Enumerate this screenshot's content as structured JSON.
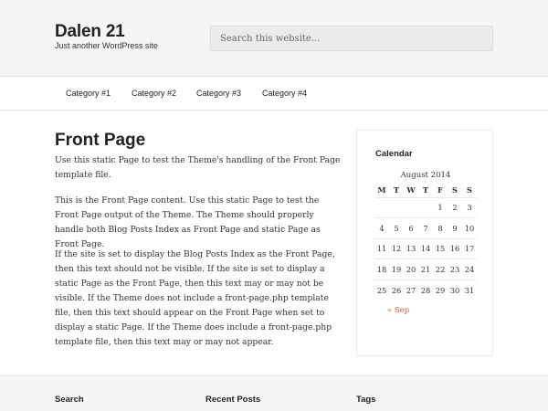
{
  "site": {
    "title": "Dalen 21",
    "tagline": "Just another WordPress site"
  },
  "search": {
    "placeholder": "Search this website..."
  },
  "nav": {
    "items": [
      "Category #1",
      "Category #2",
      "Category #3",
      "Category #4"
    ]
  },
  "page": {
    "title": "Front Page",
    "paragraphs": [
      "Use this static Page to test the Theme's handling of the Front Page template file.",
      "This is the Front Page content. Use this static Page to test the Front Page output of the Theme. The Theme should properly handle both Blog Posts Index as Front Page and static Page as Front Page.",
      "If the site is set to display the Blog Posts Index as the Front Page, then this text should not be visible. If the site is set to display a static Page as the Front Page, then this text may or may not be visible. If the Theme does not include a front-page.php template file, then this text should appear on the Front Page when set to display a static Page. If the Theme does include a front-page.php template file, then this text may or may not appear."
    ]
  },
  "calendar": {
    "widget_title": "Calendar",
    "caption": "August 2014",
    "days": [
      "M",
      "T",
      "W",
      "T",
      "F",
      "S",
      "S"
    ],
    "weeks": [
      [
        "",
        "",
        "",
        "",
        "1",
        "2",
        "3"
      ],
      [
        "4",
        "5",
        "6",
        "7",
        "8",
        "9",
        "10"
      ],
      [
        "11",
        "12",
        "13",
        "14",
        "15",
        "16",
        "17"
      ],
      [
        "18",
        "19",
        "20",
        "21",
        "22",
        "23",
        "24"
      ],
      [
        "25",
        "26",
        "27",
        "28",
        "29",
        "30",
        "31"
      ]
    ],
    "prev_link": "« Sep"
  },
  "footer": {
    "widgets": [
      "Search",
      "Recent Posts",
      "Tags"
    ]
  },
  "colors": {
    "link_accent": "#c9652b",
    "background": "#f5f5f5",
    "content_bg": "#ffffff"
  }
}
